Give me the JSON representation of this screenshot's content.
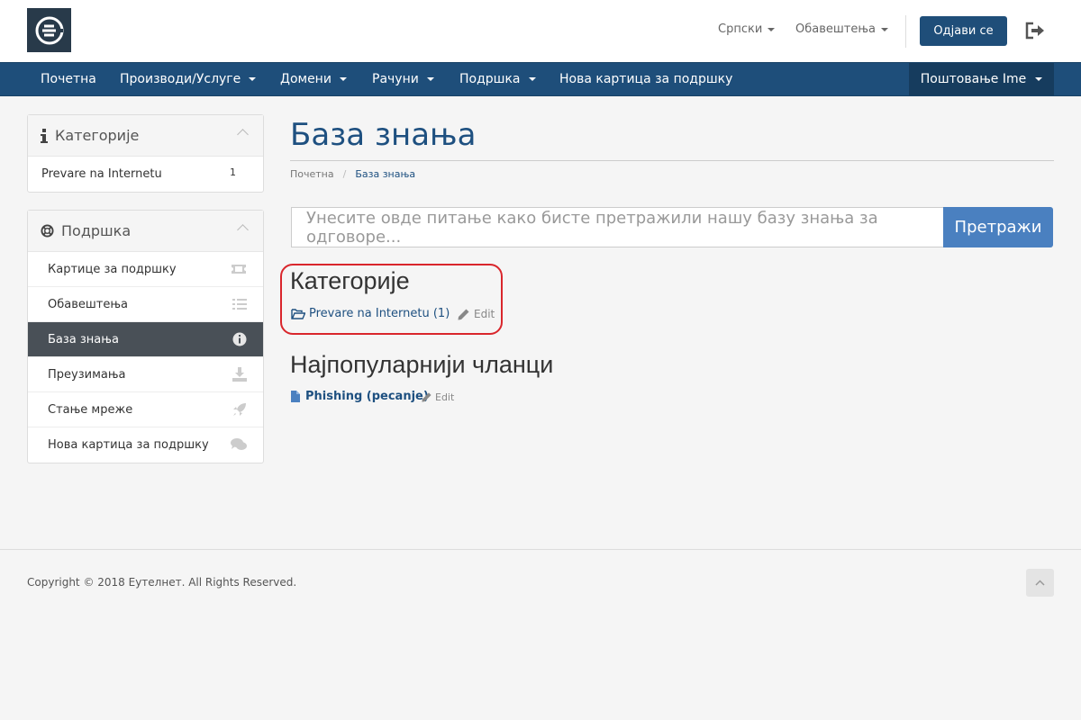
{
  "header": {
    "language_label": "Српски",
    "notifications_label": "Обавештења",
    "logout_button": "Одјави се"
  },
  "nav": {
    "items": [
      "Почетна",
      "Производи/Услуге",
      "Домени",
      "Рачуни",
      "Подршка",
      "Нова картица за подршку"
    ],
    "account_label": "Поштовање Ime"
  },
  "sidebar": {
    "categories": {
      "title": "Категорије",
      "items": [
        {
          "label": "Prevare na Internetu",
          "count": "1"
        }
      ]
    },
    "support": {
      "title": "Подршка",
      "items": [
        {
          "label": "Картице за подршку",
          "icon": "ticket-icon"
        },
        {
          "label": "Обавештења",
          "icon": "list-icon"
        },
        {
          "label": "База знања",
          "icon": "info-circle-icon",
          "active": true
        },
        {
          "label": "Преузимања",
          "icon": "download-icon"
        },
        {
          "label": "Стање мреже",
          "icon": "rocket-icon"
        },
        {
          "label": "Нова картица за подршку",
          "icon": "comments-icon"
        }
      ]
    }
  },
  "main": {
    "page_title": "База знања",
    "breadcrumb": {
      "home": "Почетна",
      "current": "База знања"
    },
    "search": {
      "placeholder": "Унесите овде питање како бисте претражили нашу базу знања за одговоре...",
      "button": "Претражи"
    },
    "categories_title": "Категорије",
    "category_link": "Prevare na Internetu (1)",
    "edit_label": "Edit",
    "popular_title": "Најпопуларнији чланци",
    "article_link": "Phishing (pecanje)"
  },
  "footer": {
    "copyright": "Copyright © 2018 Еутелнет. All Rights Reserved."
  },
  "colors": {
    "nav_bg": "#1e4e7a",
    "accent": "#4a80c0",
    "highlight": "#d9262c"
  }
}
